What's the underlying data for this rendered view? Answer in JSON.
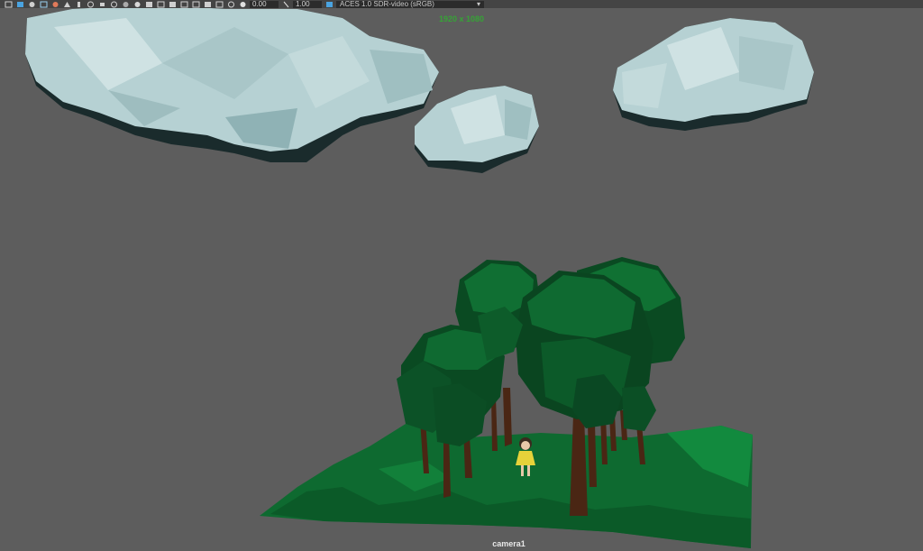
{
  "toolbar": {
    "icons": [
      "camera-attributes-icon",
      "image-plane-icon",
      "grid-icon",
      "film-gate-icon",
      "resolution-gate-icon",
      "gate-mask-icon",
      "field-chart-icon",
      "safe-action-icon",
      "safe-title-icon",
      "wireframe-icon",
      "smooth-shade-icon",
      "lighting-icon",
      "shadows-icon",
      "texture-icon",
      "isolate-icon",
      "xray-icon",
      "xray-joints-icon",
      "backface-icon",
      "aa-icon",
      "dof-icon"
    ],
    "exposure_value": "0.00",
    "gamma_value": "1.00",
    "colorspace": "ACES 1.0 SDR-video (sRGB)"
  },
  "viewport": {
    "resolution_label": "1920 x 1080",
    "camera_label": "camera1"
  },
  "colors": {
    "background": "#5d5d5d",
    "cloud": "#b8d3d4",
    "foliage": "#0b5f2b",
    "ground": "#0f6e33",
    "trunk": "#4a2614",
    "resolution_text": "#36a336"
  }
}
